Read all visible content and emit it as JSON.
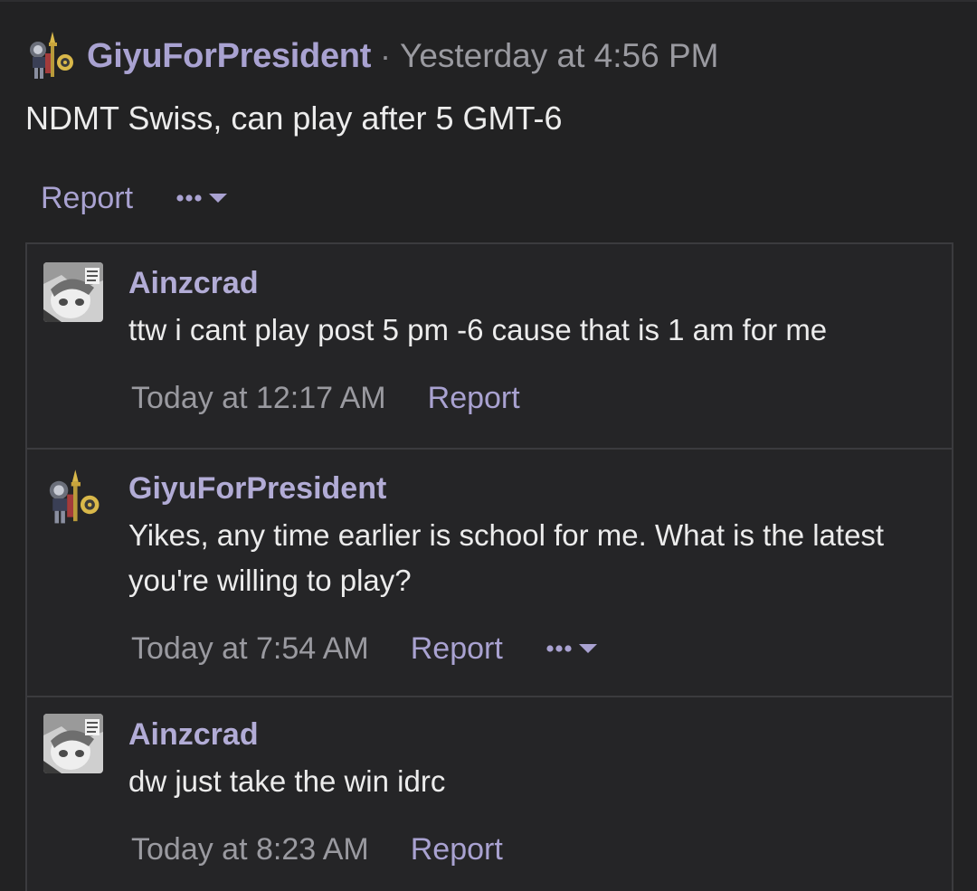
{
  "post": {
    "author": "GiyuForPresident",
    "separator": "·",
    "timestamp": "Yesterday at 4:56 PM",
    "body": "NDMT Swiss, can play after 5 GMT-6",
    "report_label": "Report",
    "more_icon": "more-dots-chevron-icon"
  },
  "replies": [
    {
      "author": "Ainzcrad",
      "text": "ttw i cant play post 5 pm -6 cause that is 1 am for me",
      "timestamp": "Today at 12:17 AM",
      "report_label": "Report"
    },
    {
      "author": "GiyuForPresident",
      "text": "Yikes, any time earlier is school for me. What is the latest you're willing to play?",
      "timestamp": "Today at 7:54 AM",
      "report_label": "Report"
    },
    {
      "author": "Ainzcrad",
      "text": "dw just take the win idrc",
      "timestamp": "Today at 8:23 AM",
      "report_label": "Report"
    }
  ],
  "colors": {
    "background": "#222223",
    "accent_link": "#a9a2d1",
    "muted_text": "#9a9aa0",
    "body_text": "#ececec",
    "border": "#3b3b3e"
  }
}
